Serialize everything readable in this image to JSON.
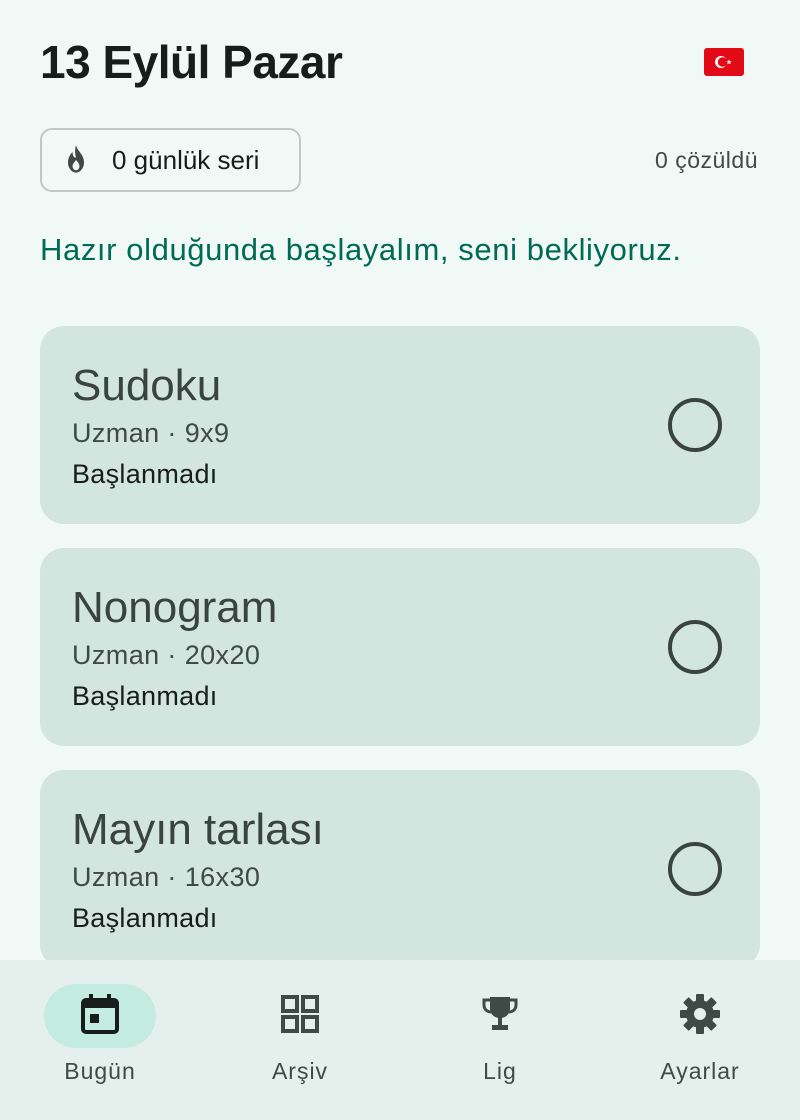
{
  "header": {
    "title": "13 Eylül Pazar",
    "flag_icon": "turkey-flag-icon",
    "flag_color": "#e30a17"
  },
  "stats": {
    "streak_label": "0 günlük seri",
    "streak_icon": "flame-icon",
    "solved_label": "0 çözüldü"
  },
  "motivation": "Hazır olduğunda başlayalım, seni bekliyoruz.",
  "puzzles": [
    {
      "title": "Sudoku",
      "subtitle": "Uzman · 9x9",
      "status": "Başlanmadı"
    },
    {
      "title": "Nonogram",
      "subtitle": "Uzman · 20x20",
      "status": "Başlanmadı"
    },
    {
      "title": "Mayın tarlası",
      "subtitle": "Uzman · 16x30",
      "status": "Başlanmadı"
    }
  ],
  "nav": {
    "items": [
      {
        "label": "Bugün",
        "icon": "calendar-icon",
        "active": true
      },
      {
        "label": "Arşiv",
        "icon": "grid-icon",
        "active": false
      },
      {
        "label": "Lig",
        "icon": "trophy-icon",
        "active": false
      },
      {
        "label": "Ayarlar",
        "icon": "gear-icon",
        "active": false
      }
    ]
  },
  "colors": {
    "accent": "#006b55",
    "card": "#d2e5df",
    "background": "#f1f9f6",
    "nav_active": "#c3ebdf"
  }
}
